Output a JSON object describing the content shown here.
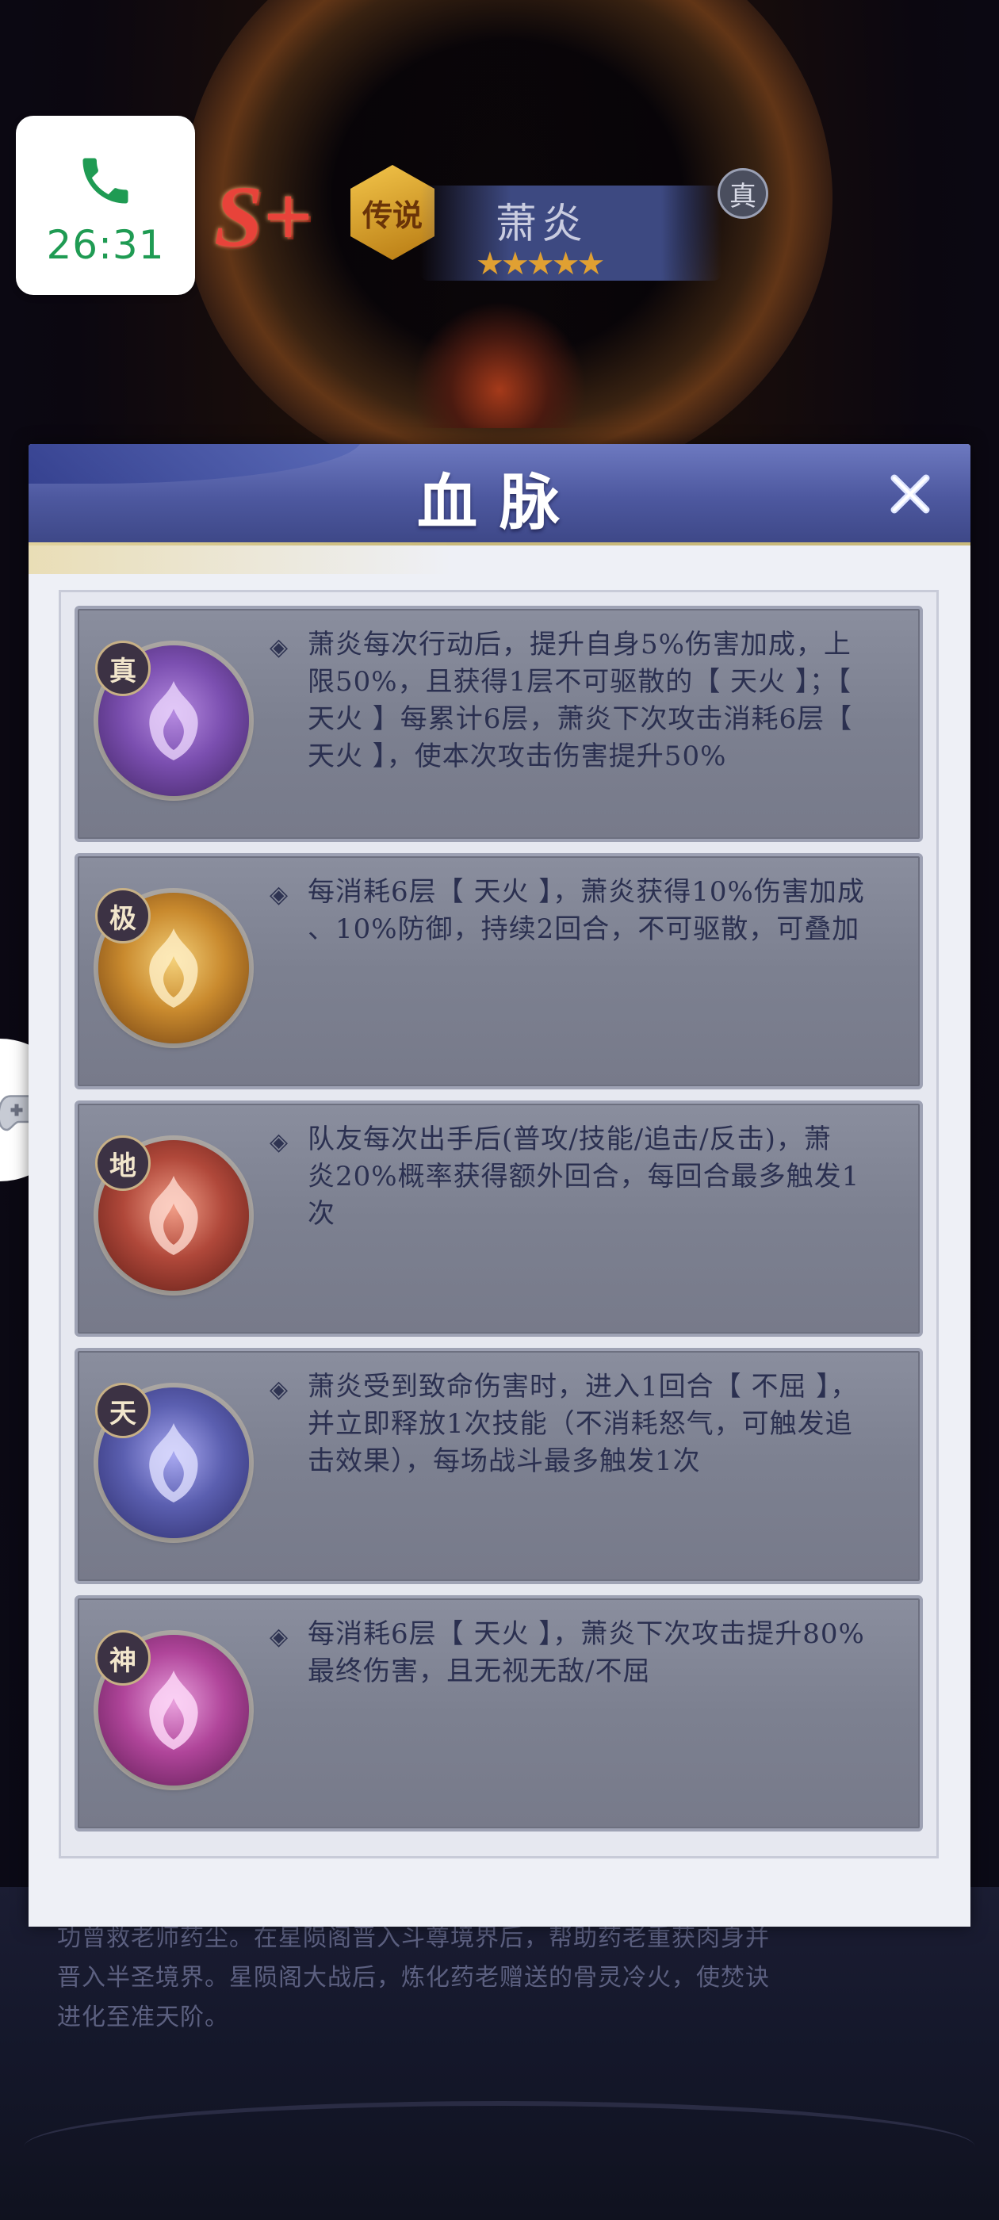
{
  "call": {
    "time": "26:31",
    "icon": "phone-icon"
  },
  "hero": {
    "rank": "S+",
    "grade": "传说",
    "name": "萧炎",
    "stars": "★★★★★",
    "true_mark": "真"
  },
  "modal": {
    "title": "血脉",
    "close_icon": "close-icon"
  },
  "cards": [
    {
      "tier": "真",
      "color": "#7b4fb0",
      "lines": [
        "萧炎每次行动后，提升自身5%伤害加成，上",
        "限50%，且获得1层不可驱散的【 天火 】；【",
        "天火 】每累计6层，萧炎下次攻击消耗6层【",
        "天火 】，使本次攻击伤害提升50%"
      ]
    },
    {
      "tier": "极",
      "color": "#c98a2e",
      "lines": [
        "每消耗6层【 天火 】，萧炎获得10%伤害加成",
        "、10%防御，持续2回合，不可驱散，可叠加"
      ]
    },
    {
      "tier": "地",
      "color": "#b0483a",
      "lines": [
        "队友每次出手后(普攻/技能/追击/反击)，萧",
        "炎20%概率获得额外回合，每回合最多触发1",
        "次"
      ]
    },
    {
      "tier": "天",
      "color": "#5b5fb0",
      "lines": [
        "萧炎受到致命伤害时，进入1回合【 不屈 】，",
        "并立即释放1次技能（不消耗怒气，可触发追",
        "击效果），每场战斗最多触发1次"
      ]
    },
    {
      "tier": "神",
      "color": "#b0459a",
      "lines": [
        "每消耗6层【 天火 】，萧炎下次攻击提升80%",
        "最终伤害，且无视无敌/不屈"
      ]
    }
  ],
  "background_text": [
    "功曾救老师药尘。在星陨阁晋入斗尊境界后，帮助药老重获肉身并",
    "晋入半圣境界。星陨阁大战后，炼化药老赠送的骨灵冷火，使焚诀",
    "进化至准天阶。"
  ]
}
